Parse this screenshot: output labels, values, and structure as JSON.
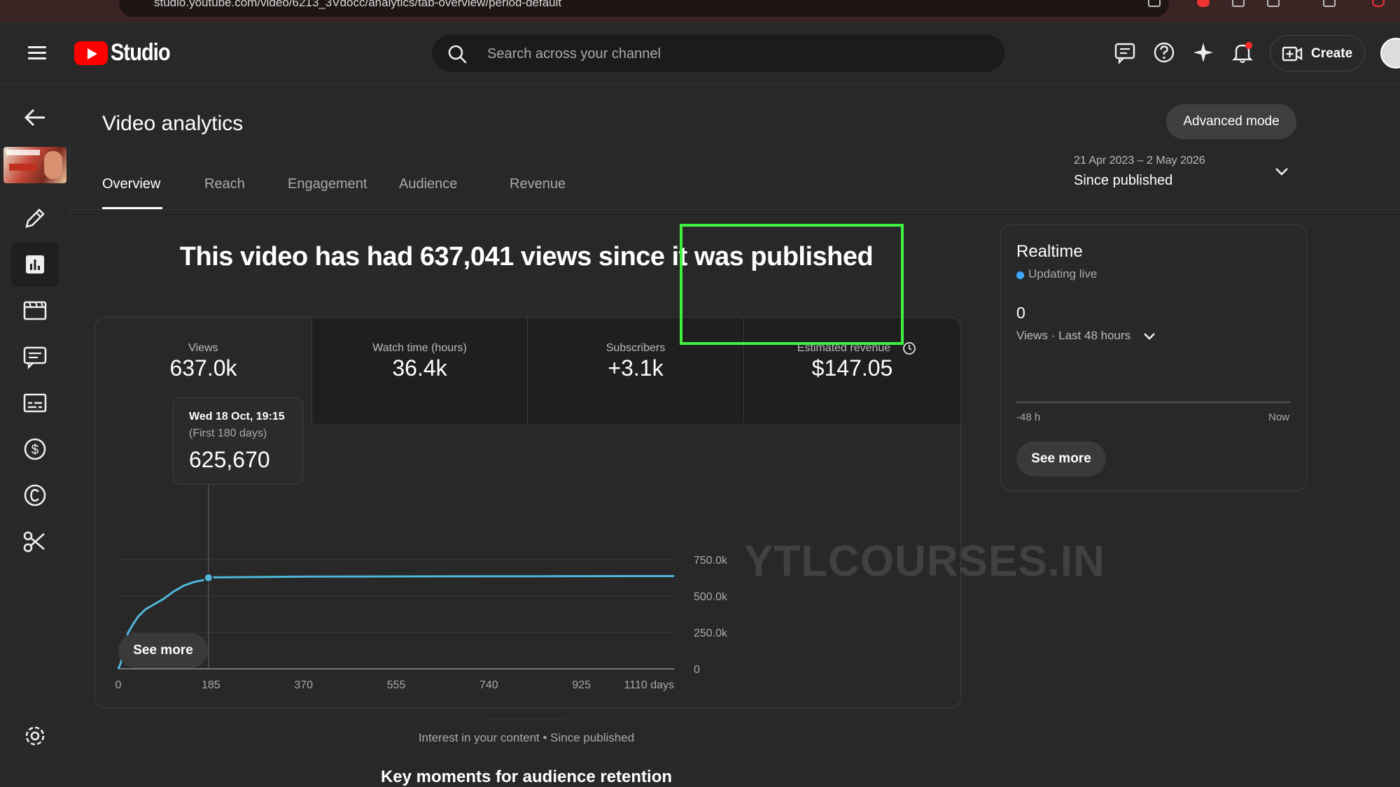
{
  "browser": {
    "url": "studio.youtube.com/video/6213_3Vdocc/analytics/tab-overview/period-default"
  },
  "header": {
    "brand": "Studio",
    "search_placeholder": "Search across your channel",
    "create_label": "Create",
    "icons": [
      "feedback-icon",
      "help-icon",
      "sparkle-icon",
      "notifications-icon",
      "create-video-icon"
    ]
  },
  "sidebar": {
    "items": [
      "back-arrow-icon",
      "video-thumbnail",
      "pencil-icon",
      "analytics-icon",
      "editor-icon",
      "comments-icon",
      "subtitles-icon",
      "monetization-icon",
      "copyright-icon",
      "clips-icon",
      "settings-icon"
    ],
    "active": "analytics-icon"
  },
  "page": {
    "title": "Video analytics",
    "advanced_mode": "Advanced mode",
    "tabs": [
      "Overview",
      "Reach",
      "Engagement",
      "Audience",
      "Revenue"
    ],
    "active_tab": "Overview",
    "date_range": "21 Apr 2023 – 2 May 2026",
    "date_label": "Since published"
  },
  "headline": "This video has had 637,041 views since it was published",
  "metrics": [
    {
      "label": "Views",
      "value": "637.0k"
    },
    {
      "label": "Watch time (hours)",
      "value": "36.4k"
    },
    {
      "label": "Subscribers",
      "value": "+3.1k"
    },
    {
      "label": "Estimated revenue",
      "value": "$147.05"
    }
  ],
  "tooltip": {
    "date": "Wed 18 Oct, 19:15",
    "subtitle": "(First 180 days)",
    "value": "625,670"
  },
  "chart_data": {
    "type": "line",
    "x": [
      0,
      5,
      10,
      15,
      20,
      30,
      40,
      55,
      70,
      90,
      110,
      130,
      150,
      170,
      180,
      185,
      370,
      555,
      740,
      925,
      1110
    ],
    "y": [
      0,
      40000,
      120000,
      200000,
      250000,
      310000,
      360000,
      410000,
      440000,
      480000,
      530000,
      570000,
      595000,
      610000,
      625670,
      628000,
      633000,
      634500,
      635500,
      636500,
      637041
    ],
    "x_ticks": [
      "0",
      "185",
      "370",
      "555",
      "740",
      "925",
      "1110 days"
    ],
    "y_ticks": [
      "750.0k",
      "500.0k",
      "250.0k",
      "0"
    ],
    "xlim": [
      0,
      1110
    ],
    "ylim": [
      0,
      750000
    ],
    "highlight_x": 180,
    "line_color": "#4fb6d8",
    "grid": true
  },
  "see_more": "See more",
  "interest": "Interest in your content • Since published",
  "key_moments": "Key moments for audience retention",
  "realtime": {
    "title": "Realtime",
    "live": "Updating live",
    "count": "0",
    "views_label": "Views · Last 48 hours",
    "axis_left": "-48 h",
    "axis_right": "Now",
    "see_more": "See more"
  },
  "watermark": "YTLCOURSES.IN"
}
